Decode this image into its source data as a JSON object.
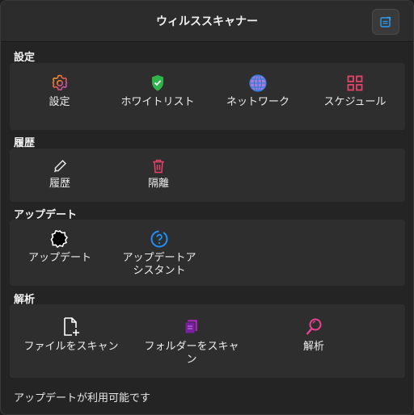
{
  "window": {
    "title": "ウィルススキャナー"
  },
  "sections": {
    "settings": {
      "header": "設定",
      "items": [
        "設定",
        "ホワイトリスト",
        "ネットワーク",
        "スケジュール"
      ]
    },
    "history": {
      "header": "履歴",
      "items": [
        "履歴",
        "隔離"
      ]
    },
    "update": {
      "header": "アップデート",
      "items": [
        "アップデート",
        "アップデートア",
        "シスタント"
      ]
    },
    "analysis": {
      "header": "解析",
      "items": [
        "ファイルをスキャン",
        "フォルダーをスキャ",
        "ン",
        "解析"
      ]
    }
  },
  "status": {
    "text": "アップデートが利用可能です"
  },
  "colors": {
    "gear": "#e8564a",
    "shield": "#2fb44a",
    "globe": "#a77dd8",
    "grid": "#e5436a",
    "trash": "#e5436a",
    "update_assistant": "#1e90ff",
    "folder": "#9c27b0",
    "magnifier": "#e84393"
  },
  "icons": {
    "menu": "menu-icon",
    "settings": "gear-icon",
    "whitelist": "shield-check-icon",
    "network": "globe-icon",
    "schedule": "grid-icon",
    "history": "pencil-icon",
    "quarantine": "trash-icon",
    "update": "badge-icon",
    "update_assistant": "question-circle-icon",
    "scan_file": "file-add-icon",
    "scan_folder": "folder-icon",
    "analysis": "magnifier-icon"
  }
}
